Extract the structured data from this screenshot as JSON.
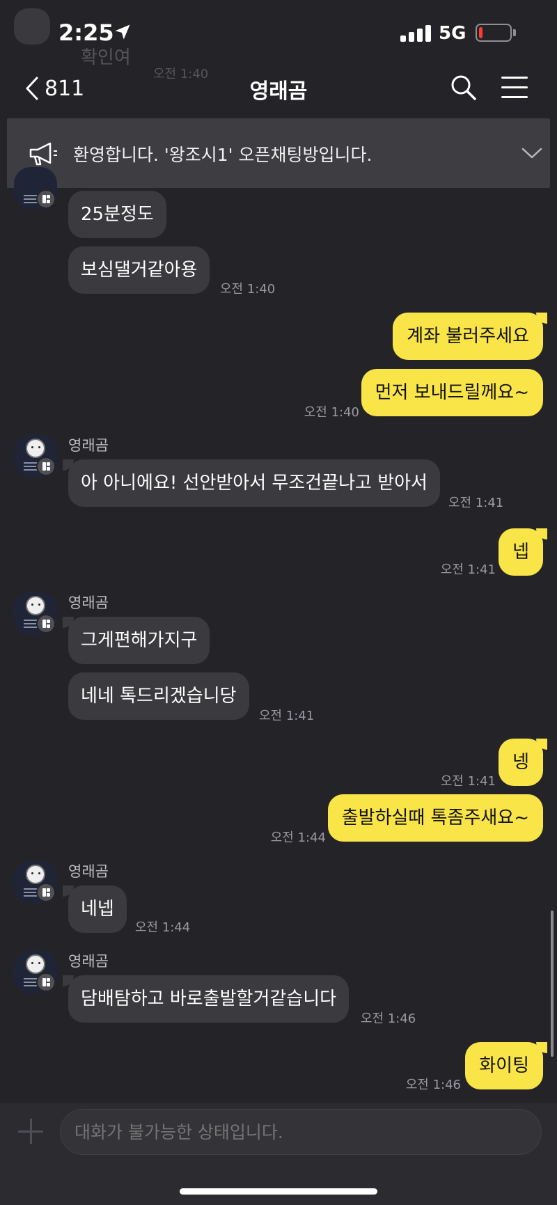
{
  "status_bar": {
    "time": "2:25",
    "network": "5G",
    "battery_level": 0.12,
    "battery_color": "#ff3b30"
  },
  "header": {
    "back_count": "811",
    "title": "영래곰"
  },
  "ghost": {
    "prev_message": "확인여",
    "prev_time": "오전 1:40"
  },
  "notice": {
    "text": "환영합니다. '왕조시1' 오픈채팅방입니다."
  },
  "colors": {
    "background": "#242428",
    "incoming_bubble": "#3b3b3f",
    "outgoing_bubble": "#f9e547"
  },
  "messages": [
    {
      "text": "25분정도"
    },
    {
      "text": "보심댈거같아용",
      "time": "오전 1:40"
    },
    {
      "text": "계좌 불러주세요"
    },
    {
      "text": "먼저 보내드릴께요~",
      "time": "오전 1:40"
    },
    {
      "sender": "영래곰",
      "text": "아 아니에요! 선안받아서 무조건끝나고 받아서",
      "time": "오전 1:41"
    },
    {
      "text": "넵",
      "time": "오전 1:41"
    },
    {
      "sender": "영래곰",
      "text": "그게편해가지구"
    },
    {
      "text": "네네 톡드리겠습니당",
      "time": "오전 1:41"
    },
    {
      "text": "넹",
      "time": "오전 1:41"
    },
    {
      "text": "출발하실때 톡좀주새요~",
      "time": "오전 1:44"
    },
    {
      "sender": "영래곰",
      "text": "네넵",
      "time": "오전 1:44"
    },
    {
      "sender": "영래곰",
      "text": "담배탐하고 바로출발할거같습니다",
      "time": "오전 1:46"
    },
    {
      "text": "화이팅",
      "time": "오전 1:46"
    }
  ],
  "input": {
    "placeholder": "대화가 불가능한 상태입니다."
  },
  "icons": {
    "back": "chevron-left-icon",
    "search": "search-icon",
    "menu": "hamburger-menu-icon",
    "notice": "megaphone-icon",
    "expand": "chevron-down-icon",
    "attach": "plus-icon",
    "location": "location-arrow-icon"
  }
}
